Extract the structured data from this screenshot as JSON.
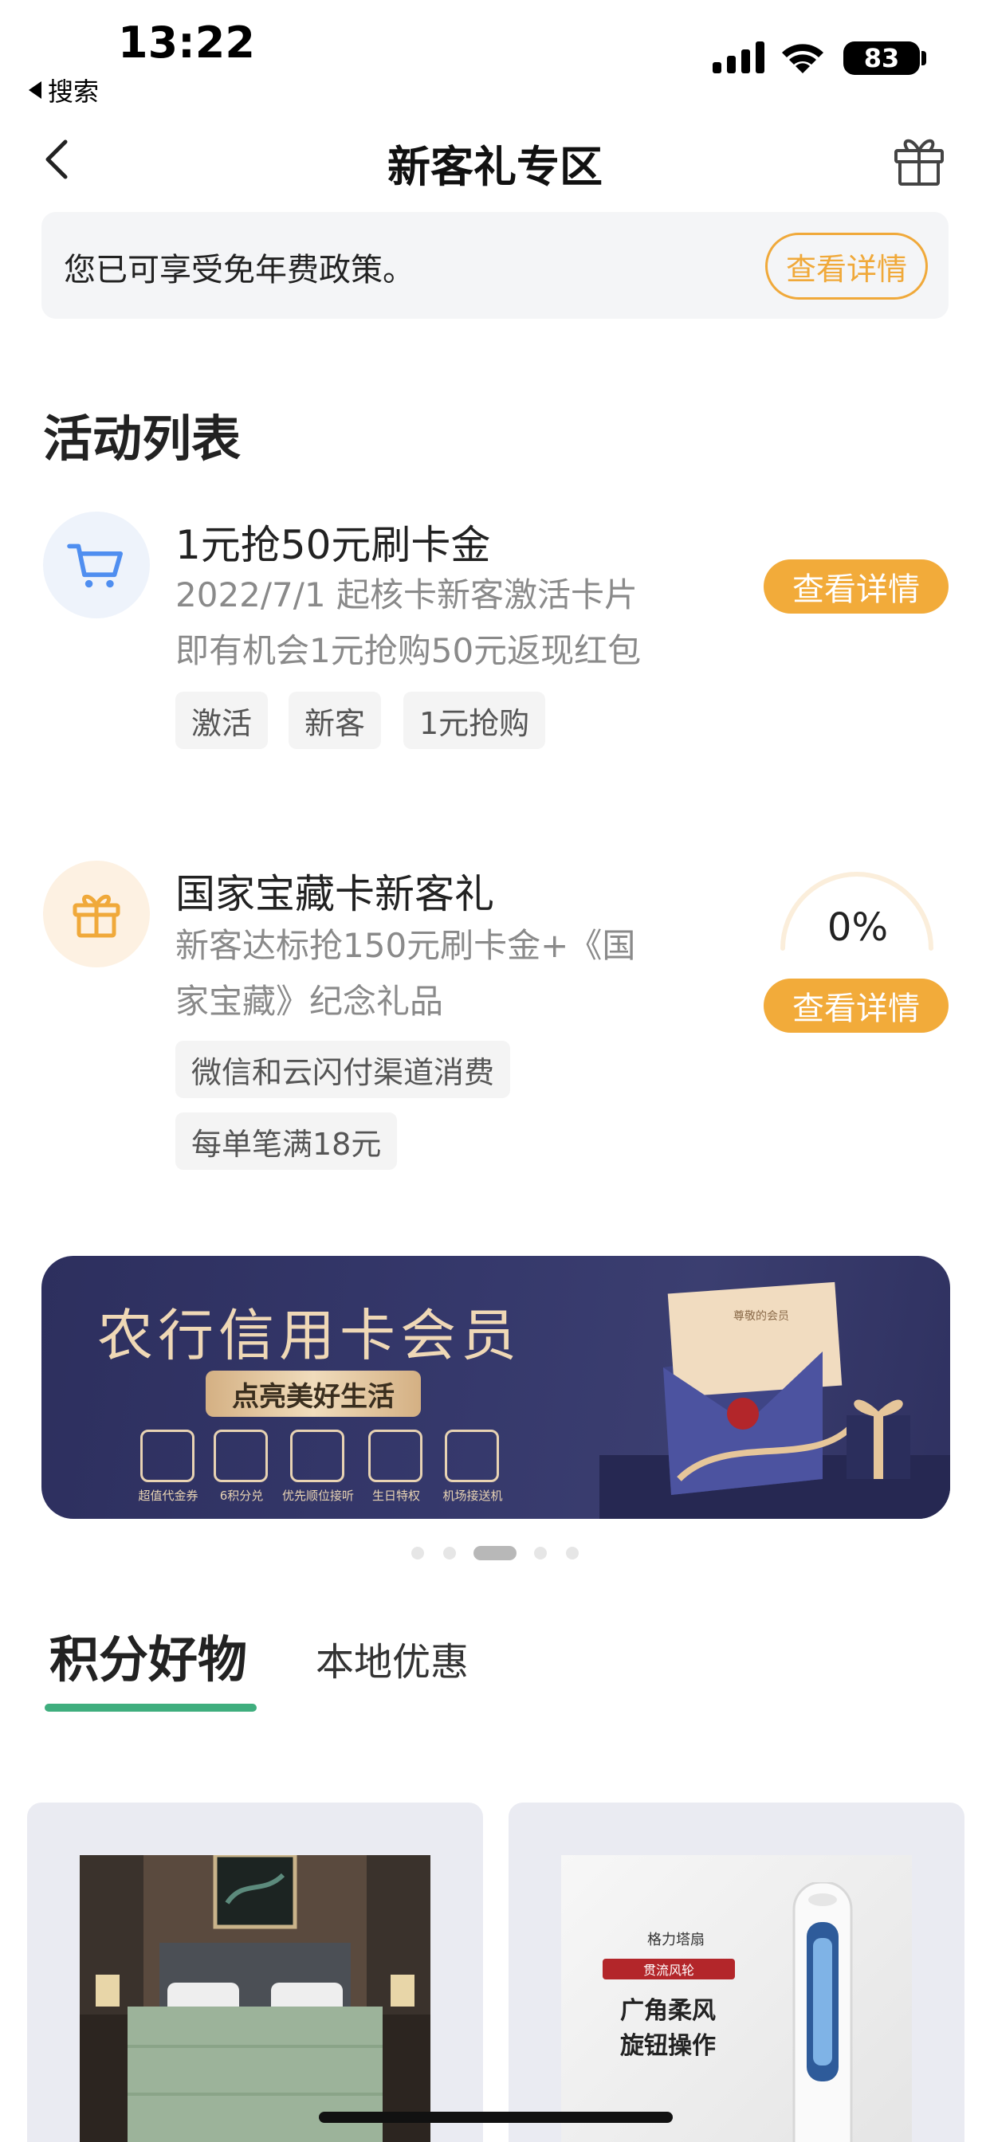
{
  "status_bar": {
    "time": "13:22",
    "back_app": "搜索",
    "battery": "83"
  },
  "nav": {
    "title": "新客礼专区",
    "back_icon": "chevron-left-icon",
    "gift_icon": "gift-icon"
  },
  "notice": {
    "text": "您已可享受免年费政策。",
    "button": "查看详情"
  },
  "section_title": "活动列表",
  "activities": [
    {
      "icon": "cart-icon",
      "title": "1元抢50元刷卡金",
      "desc_line1": "2022/7/1 起核卡新客激活卡片",
      "desc_line2": "即有机会1元抢购50元返现红包",
      "tags": [
        "激活",
        "新客",
        "1元抢购"
      ],
      "button": "查看详情"
    },
    {
      "icon": "gift-icon",
      "title": "国家宝藏卡新客礼",
      "desc_line1": "新客达标抢150元刷卡金+《国",
      "desc_line2": "家宝藏》纪念礼品",
      "tags": [
        "微信和云闪付渠道消费",
        "每单笔满18元"
      ],
      "progress": "0%",
      "progress_value": 0,
      "button": "查看详情"
    }
  ],
  "banner": {
    "title": "农行信用卡会员",
    "subtitle": "点亮美好生活",
    "benefits": [
      "超值代金券",
      "6积分兑",
      "优先顺位接听",
      "生日特权",
      "机场接送机"
    ],
    "envelope_text": "尊敬的会员",
    "carousel_active_index": 2,
    "carousel_count": 5
  },
  "tabs": {
    "active": "积分好物",
    "other": "本地优惠"
  },
  "products": [
    {
      "image": "bedroom-bedding-photo"
    },
    {
      "image": "tower-fan-photo",
      "brand": "格力塔扇",
      "badge": "贯流风轮",
      "line1": "广角柔风",
      "line2": "旋钮操作"
    }
  ],
  "colors": {
    "accent": "#f2ab3a",
    "tab_underline": "#3fae7e",
    "banner_bg": "#33366a",
    "banner_gold": "#efd8b6"
  }
}
